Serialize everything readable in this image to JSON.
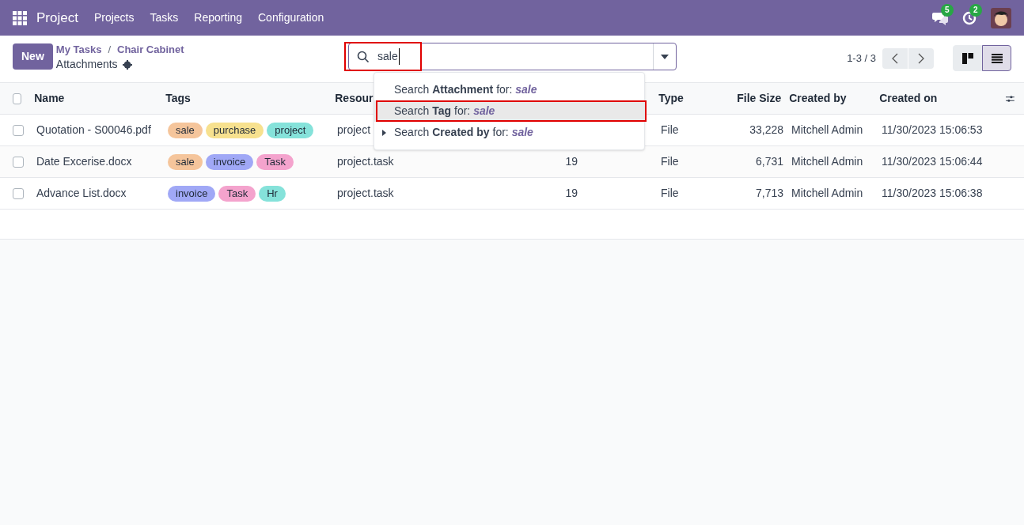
{
  "navbar": {
    "app": "Project",
    "menu": [
      "Projects",
      "Tasks",
      "Reporting",
      "Configuration"
    ],
    "messages_badge": "5",
    "activities_badge": "2"
  },
  "control_panel": {
    "new_button": "New",
    "breadcrumb": [
      "My Tasks",
      "Chair Cabinet"
    ],
    "breadcrumb_separator": "/",
    "title": "Attachments",
    "pager": "1-3 / 3",
    "views": [
      {
        "kind": "kanban",
        "selected": false
      },
      {
        "kind": "list",
        "selected": true
      }
    ]
  },
  "search": {
    "value": "sale",
    "annotated": true,
    "suggestions": [
      {
        "text": "Search **Attachment** for: *sale*",
        "selected": false,
        "annotated": false,
        "expandable": false
      },
      {
        "text": "Search **Tag** for: *sale*",
        "selected": true,
        "annotated": true,
        "expandable": false
      },
      {
        "text": "Search **Created by** for: *sale*",
        "selected": false,
        "annotated": false,
        "expandable": true
      }
    ]
  },
  "table": {
    "all_selected": false,
    "columns": [
      "Name",
      "Tags",
      "Resour",
      "",
      "Type",
      "File Size",
      "Created by",
      "Created on"
    ],
    "rows": [
      {
        "checked": false,
        "name": "Quotation - S00046.pdf",
        "tags": [
          {
            "label": "sale",
            "color": "#f5c59b"
          },
          {
            "label": "purchase",
            "color": "#f7e18f"
          },
          {
            "label": "project",
            "color": "#85e2da"
          }
        ],
        "resource": "project",
        "resource_id": "",
        "type": "File",
        "size": "33,228",
        "created_by": "Mitchell Admin",
        "created_on": "11/30/2023 15:06:53"
      },
      {
        "checked": false,
        "name": "Date Excerise.docx",
        "tags": [
          {
            "label": "sale",
            "color": "#f5c59b"
          },
          {
            "label": "invoice",
            "color": "#a0a8f6"
          },
          {
            "label": "Task",
            "color": "#f4a3cd"
          }
        ],
        "resource": "project.task",
        "resource_id": "19",
        "type": "File",
        "size": "6,731",
        "created_by": "Mitchell Admin",
        "created_on": "11/30/2023 15:06:44"
      },
      {
        "checked": false,
        "name": "Advance List.docx",
        "tags": [
          {
            "label": "invoice",
            "color": "#a0a8f6"
          },
          {
            "label": "Task",
            "color": "#f4a3cd"
          },
          {
            "label": "Hr",
            "color": "#85e2da"
          }
        ],
        "resource": "project.task",
        "resource_id": "19",
        "type": "File",
        "size": "7,713",
        "created_by": "Mitchell Admin",
        "created_on": "11/30/2023 15:06:38"
      }
    ]
  }
}
